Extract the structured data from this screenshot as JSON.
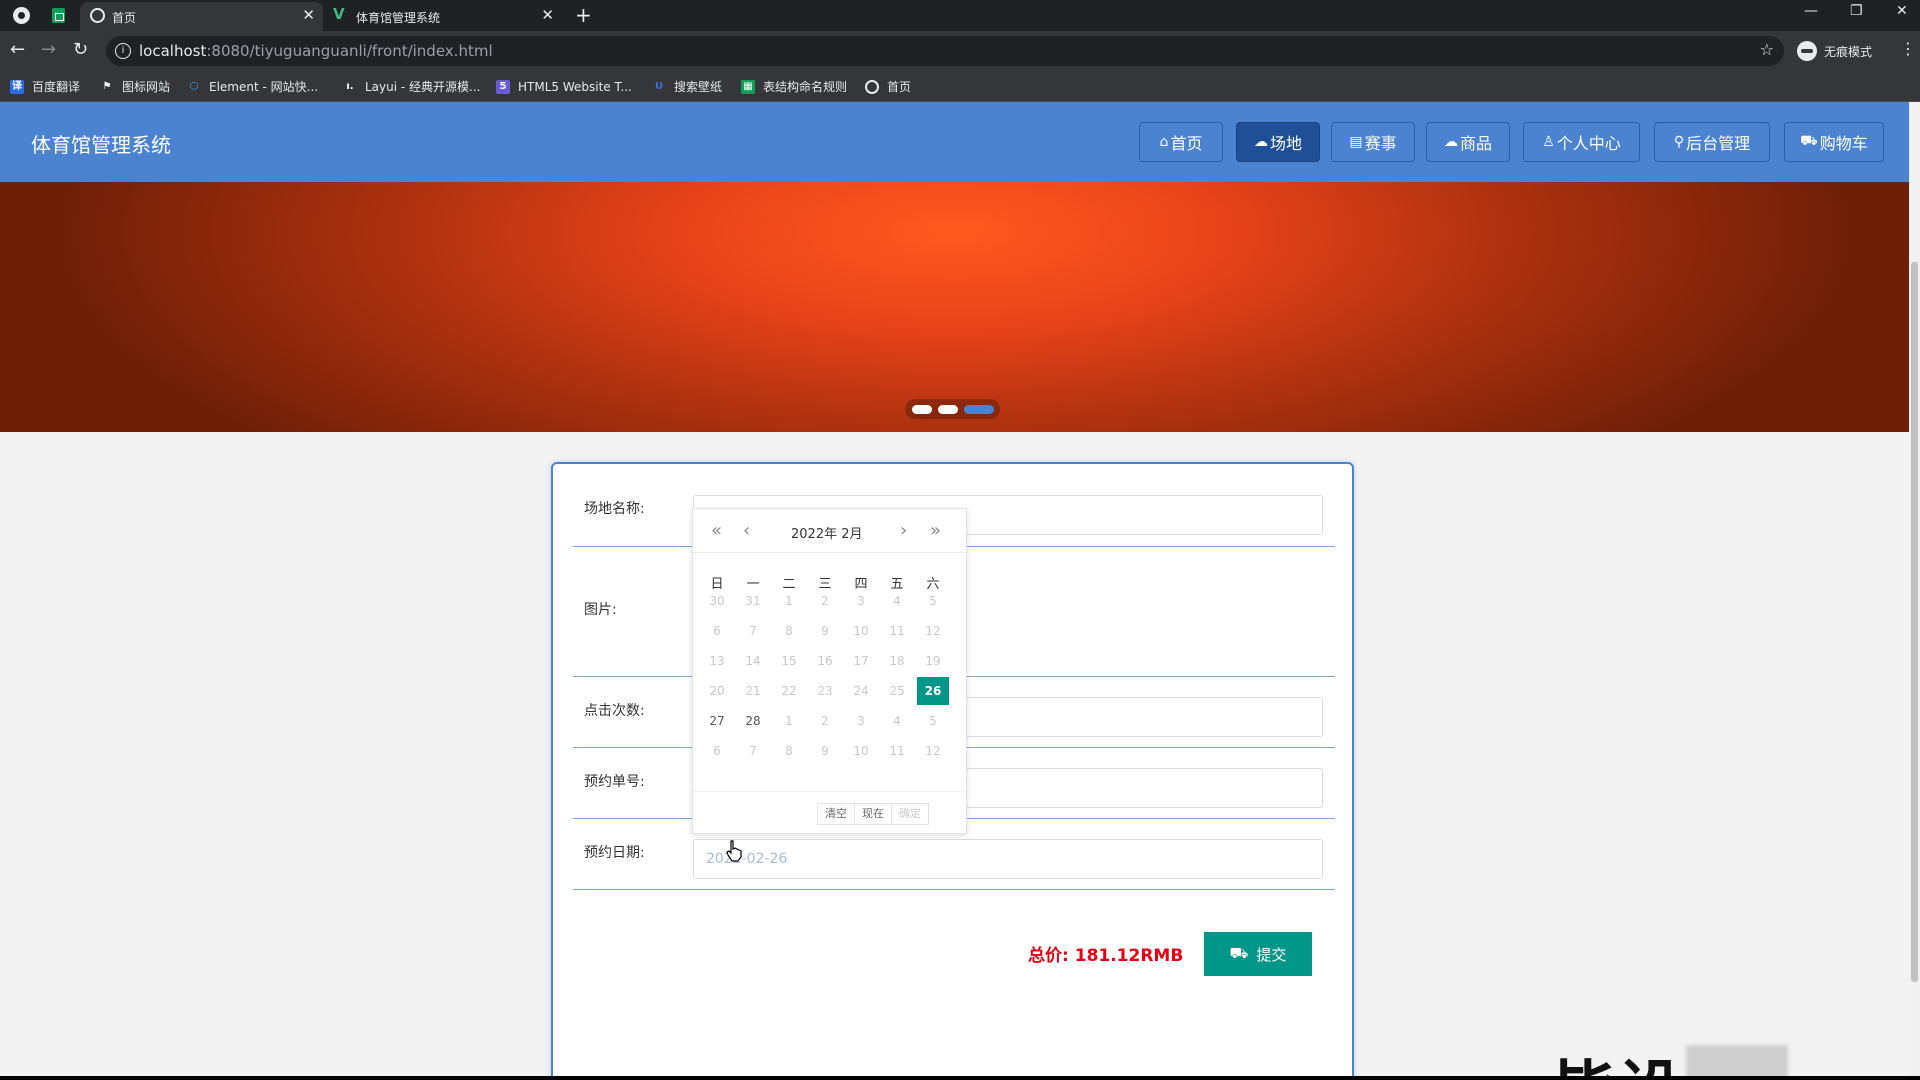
{
  "browser": {
    "tabs": [
      {
        "title": "首页",
        "active": true
      },
      {
        "title": "体育馆管理系统",
        "active": false
      }
    ],
    "url_host": "localhost",
    "url_path": ":8080/tiyuguanguanli/front/index.html",
    "incognito_label": "无痕模式",
    "bookmarks": [
      {
        "label": "百度翻译",
        "icon": "translate-icon",
        "color": "#2b6de5"
      },
      {
        "label": "图标网站",
        "icon": "flag-icon",
        "color": "#35363a"
      },
      {
        "label": "Element - 网站快...",
        "icon": "element-icon",
        "color": "#409eff"
      },
      {
        "label": "Layui - 经典开源模...",
        "icon": "layui-icon",
        "color": "#35363a"
      },
      {
        "label": "HTML5 Website T...",
        "icon": "html5-icon",
        "color": "#6b5bd6"
      },
      {
        "label": "搜索壁纸",
        "icon": "wallpaper-icon",
        "color": "#3a6fd8"
      },
      {
        "label": "表结构命名规则",
        "icon": "sheet-icon",
        "color": "#0f9d58"
      },
      {
        "label": "首页",
        "icon": "globe-icon",
        "color": "#35363a"
      }
    ]
  },
  "site": {
    "title": "体育馆管理系统",
    "nav": [
      {
        "label": "首页",
        "icon": "⌂",
        "active": false
      },
      {
        "label": "场地",
        "icon": "☁",
        "active": true
      },
      {
        "label": "赛事",
        "icon": "▤",
        "active": false
      },
      {
        "label": "商品",
        "icon": "☁",
        "active": false
      },
      {
        "label": "个人中心",
        "icon": "♙",
        "active": false
      },
      {
        "label": "后台管理",
        "icon": "⚲",
        "active": false
      },
      {
        "label": "购物车",
        "icon": "⛟",
        "active": false
      }
    ],
    "banner_dots": 3,
    "banner_active_dot": 3
  },
  "form": {
    "venue_name_label": "场地名称:",
    "image_label": "图片:",
    "clicks_label": "点击次数:",
    "order_no_label": "预约单号:",
    "date_label": "预约日期:",
    "date_value": "2022-02-26",
    "total_label": "总价:",
    "total_value": "181.12RMB",
    "submit_label": "提交"
  },
  "datepicker": {
    "year_month": "2022年  2月",
    "weekdays": [
      "日",
      "一",
      "二",
      "三",
      "四",
      "五",
      "六"
    ],
    "weeks": [
      [
        "30",
        "31",
        "1",
        "2",
        "3",
        "4",
        "5"
      ],
      [
        "6",
        "7",
        "8",
        "9",
        "10",
        "11",
        "12"
      ],
      [
        "13",
        "14",
        "15",
        "16",
        "17",
        "18",
        "19"
      ],
      [
        "20",
        "21",
        "22",
        "23",
        "24",
        "25",
        "26"
      ],
      [
        "27",
        "28",
        "1",
        "2",
        "3",
        "4",
        "5"
      ],
      [
        "6",
        "7",
        "8",
        "9",
        "10",
        "11",
        "12"
      ]
    ],
    "selected": "26",
    "clear_label": "清空",
    "now_label": "现在",
    "confirm_label": "确定"
  },
  "watermark": "毕设"
}
